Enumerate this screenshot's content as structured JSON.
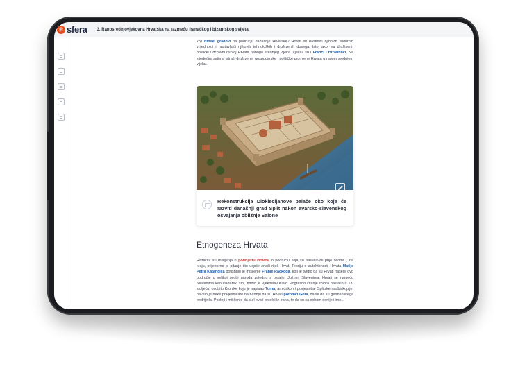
{
  "app": {
    "logo_mark": "e",
    "logo_text": "sfera"
  },
  "header": {
    "chapter_title": "3. Ranosrednjovjekovna Hrvatska na razmeđu franačkog i bizantskog svijeta"
  },
  "intro": {
    "t1": "koji ",
    "k1": "rimski gradovi",
    "t2": " na području današnje Hrvatske? Hrvati su baštinici njihovih kulturnih vrijednosti i nastavljači njihovih tehnoloških i društvenih dosega. Isto tako, na društveni, politički i državni razvoj Hrvata nanoga srednjeg vijeka utjecali su i ",
    "k2": "Franci i Bizantinci",
    "t3": ". Na sljedećim satima istraži društvene, gospodarske i političke promjene Hrvata u ranom srednjem vijeku."
  },
  "figure": {
    "caption": "Rekonstrukcija Dioklecijanove palače oko koje će razviti današnji grad Split nakon avarsko-slavenskog osvajanja obližnje Salone",
    "icons": {
      "expand": "expand-icon",
      "caption": "image-caption-icon"
    }
  },
  "section": {
    "title": "Etnogeneza Hrvata"
  },
  "body": {
    "t1": "Različita su mišljenja o ",
    "k1": "podrijetlu Hrvata",
    "t2": ", o području koja su naseljavali prije seobe i, na kraju, prijeporno je pitanje što uopće znači riječ Hrvat. Teoriju o autohtonosti Hrvata ",
    "k2": "Matije Petra Katančića",
    "t3": " potisnulo je mišljenje ",
    "k3": "Franje Račkoga",
    "t4": ", koji je tvrdio da su Hrvati naselili ovo područje u velikoj seobi naroda zajedno s ostalim Južnim Slavenima. Hrvati se nameću Slavenima kao vladarski sloj, tvrdio je Vjekoslav Klaić. Pogrešno čitanje izvora nastalih u 13. stoljeću, osobito Kronike koju je napisao ",
    "k4": "Toma",
    "t5": ", arhiđakon i povjesničar Splitske nadbiskupije, navelo je neke povjesničare na tvrdnju da su Hrvati ",
    "k5": "potomci Gota",
    "t6": ", dakle da su germanskega podrijetla. Postoji i mišljenje da su Hrvati potekli iz Irana, te da su sa sobom donijeli ime..."
  },
  "sidebar": {
    "icons": [
      "edit-icon",
      "gallery-icon",
      "list-icon",
      "video-icon",
      "quiz-icon"
    ]
  },
  "colors": {
    "accent": "#e8501f",
    "link": "#1d5fb4",
    "highlight": "#c8332b"
  }
}
